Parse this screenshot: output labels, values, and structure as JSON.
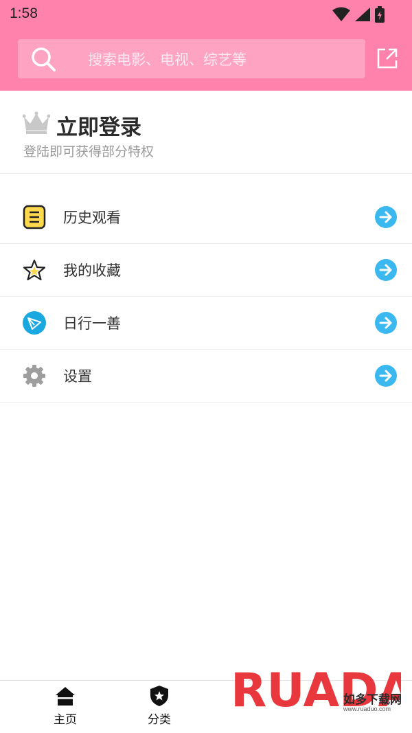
{
  "status_bar": {
    "time": "1:58"
  },
  "search": {
    "placeholder": "搜索电影、电视、综艺等"
  },
  "login": {
    "title": "立即登录",
    "subtitle": "登陆即可获得部分特权"
  },
  "menu": {
    "items": [
      {
        "label": "历史观看",
        "icon": "history-icon"
      },
      {
        "label": "我的收藏",
        "icon": "star-icon"
      },
      {
        "label": "日行一善",
        "icon": "paper-plane-icon"
      },
      {
        "label": "设置",
        "icon": "gear-icon"
      }
    ]
  },
  "bottom_nav": {
    "items": [
      {
        "label": "主页",
        "icon": "home-icon"
      },
      {
        "label": "分类",
        "icon": "shield-star-icon"
      }
    ]
  },
  "watermark": {
    "logo": "RUADADO",
    "name": "如多下载网",
    "url": "www.ruaduo.com"
  },
  "colors": {
    "header": "#ff82ad",
    "search_bg": "#ffa3c3",
    "arrow": "#3bb8ef",
    "history_icon": "#ffd84d",
    "star_icon": "#ffd84d",
    "plane_icon": "#1aa8e0",
    "gear_icon": "#9e9e9e"
  }
}
